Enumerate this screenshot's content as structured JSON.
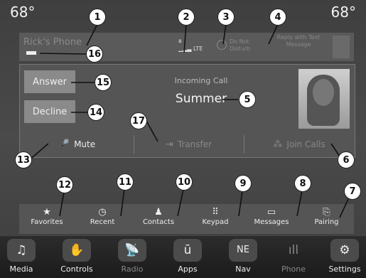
{
  "status": {
    "temp_left": "68°",
    "temp_right": "68°"
  },
  "top_bar": {
    "phone_name": "Rick's Phone",
    "network": "LTE",
    "bluetooth_glyph": "ʙ",
    "dnd_label": "Do Not Disturb",
    "reply_label": "Reply with Text Message"
  },
  "call": {
    "answer": "Answer",
    "decline": "Decline",
    "incoming": "Incoming Call",
    "caller": "Summer",
    "mute": "Mute",
    "transfer": "Transfer",
    "join": "Join Calls"
  },
  "nav": [
    {
      "label": "Favorites",
      "icon": "star-icon",
      "glyph": "★"
    },
    {
      "label": "Recent",
      "icon": "clock-icon",
      "glyph": "◷"
    },
    {
      "label": "Contacts",
      "icon": "person-icon",
      "glyph": "♟"
    },
    {
      "label": "Keypad",
      "icon": "keypad-icon",
      "glyph": "⠿"
    },
    {
      "label": "Messages",
      "icon": "message-icon",
      "glyph": "▭"
    },
    {
      "label": "Pairing",
      "icon": "pairing-icon",
      "glyph": "⎘"
    }
  ],
  "dock": [
    {
      "label": "Media",
      "icon": "music-icon",
      "glyph": "♫"
    },
    {
      "label": "Controls",
      "icon": "controls-icon",
      "glyph": "✋"
    },
    {
      "label": "Radio",
      "icon": "radio-icon",
      "glyph": "📡"
    },
    {
      "label": "Apps",
      "icon": "apps-icon",
      "glyph": "ū"
    },
    {
      "label": "Nav",
      "icon": "compass-icon",
      "glyph": "NE"
    },
    {
      "label": "Phone",
      "icon": "phone-icon",
      "glyph": "ıll"
    },
    {
      "label": "Settings",
      "icon": "gear-icon",
      "glyph": "⚙"
    }
  ],
  "callouts": [
    "1",
    "2",
    "3",
    "4",
    "5",
    "6",
    "7",
    "8",
    "9",
    "10",
    "11",
    "12",
    "13",
    "14",
    "15",
    "16",
    "17"
  ]
}
